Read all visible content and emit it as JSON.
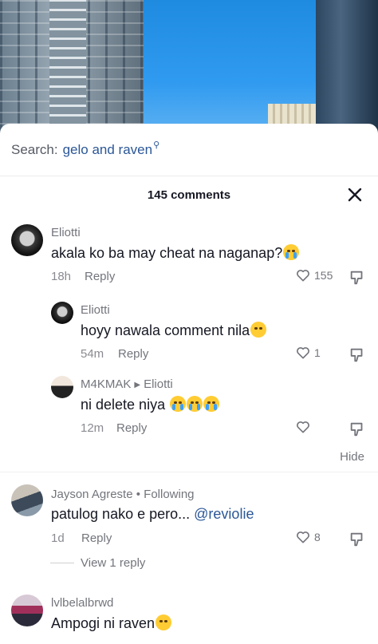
{
  "search": {
    "prefix": "Search:",
    "query": "gelo and raven"
  },
  "header": {
    "title": "145 comments"
  },
  "comments": [
    {
      "username": "Eliotti",
      "text": "akala ko ba may cheat na naganap?",
      "emoji": "loudly-crying-face",
      "time": "18h",
      "reply_label": "Reply",
      "likes": "155"
    },
    {
      "username": "Eliotti",
      "text": "hoyy nawala comment nila",
      "emoji": "flushed-face",
      "time": "54m",
      "reply_label": "Reply",
      "likes": "1"
    },
    {
      "username": "M4KMAK",
      "reply_to": "Eliotti",
      "text": "ni delete niya",
      "emoji": "loudly-crying-face x3",
      "time": "12m",
      "reply_label": "Reply",
      "likes": ""
    },
    {
      "username": "Jayson Agreste",
      "badge": "Following",
      "text": "patulog nako e pero...",
      "mention": "@reviolie",
      "time": "1d",
      "reply_label": "Reply",
      "likes": "8"
    },
    {
      "username": "lvlbelalbrwd",
      "text": "Ampogi ni raven",
      "emoji": "pleading-face"
    }
  ],
  "hide_label": "Hide",
  "view_replies_label": "View 1 reply",
  "icons": [
    "close-icon",
    "heart-icon",
    "thumbs-down-icon",
    "play-arrow-icon"
  ]
}
